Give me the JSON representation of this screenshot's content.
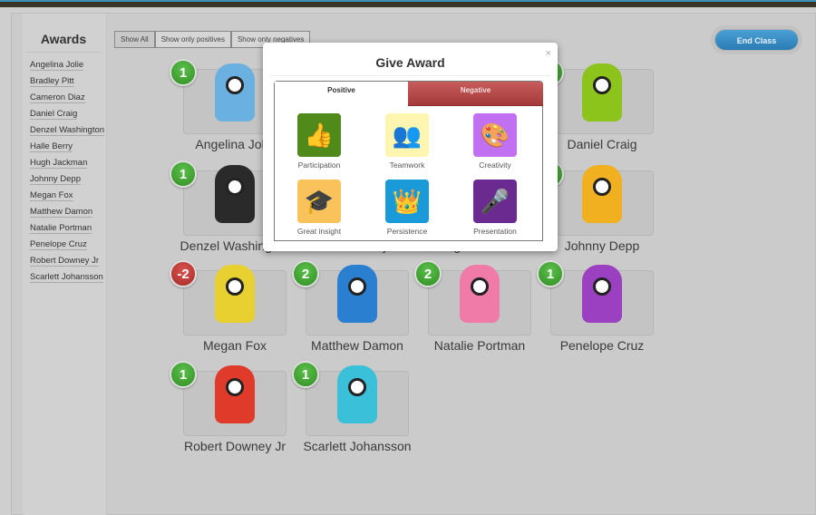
{
  "sidebar": {
    "title": "Awards",
    "students": [
      "Angelina Jolie",
      "Bradley Pitt",
      "Cameron Diaz",
      "Daniel Craig",
      "Denzel Washington",
      "Halle Berry",
      "Hugh Jackman",
      "Johnny Depp",
      "Megan Fox",
      "Matthew Damon",
      "Natalie Portman",
      "Penelope Cruz",
      "Robert Downey Jr",
      "Scarlett Johansson"
    ]
  },
  "filters": {
    "show_all": "Show All",
    "positives": "Show only positives",
    "negatives": "Show only negatives"
  },
  "end_class": "End Class",
  "cards": [
    {
      "name": "Angelina Jolie",
      "points": "1",
      "type": "pos",
      "color": "#6ab0e0"
    },
    {
      "name": "Bradley Pitt",
      "points": "",
      "type": "pos",
      "color": "#888"
    },
    {
      "name": "Cameron Diaz",
      "points": "",
      "type": "pos",
      "color": "#888"
    },
    {
      "name": "Daniel Craig",
      "points": "",
      "type": "pos",
      "color": "#8cc41c"
    },
    {
      "name": "Denzel Washington",
      "points": "1",
      "type": "pos",
      "color": "#2a2a2a"
    },
    {
      "name": "Halle Berry",
      "points": "",
      "type": "pos",
      "color": "#888"
    },
    {
      "name": "Hugh Jackman",
      "points": "",
      "type": "pos",
      "color": "#888"
    },
    {
      "name": "Johnny Depp",
      "points": "",
      "type": "pos",
      "color": "#f0b020"
    },
    {
      "name": "Megan Fox",
      "points": "-2",
      "type": "neg",
      "color": "#e8d030"
    },
    {
      "name": "Matthew Damon",
      "points": "2",
      "type": "pos",
      "color": "#2a7fd0"
    },
    {
      "name": "Natalie Portman",
      "points": "2",
      "type": "pos",
      "color": "#f07aa8"
    },
    {
      "name": "Penelope Cruz",
      "points": "1",
      "type": "pos",
      "color": "#9a40c0"
    },
    {
      "name": "Robert Downey Jr",
      "points": "1",
      "type": "pos",
      "color": "#e03a2a"
    },
    {
      "name": "Scarlett Johansson",
      "points": "1",
      "type": "pos",
      "color": "#3ac0d8"
    }
  ],
  "modal": {
    "title": "Give Award",
    "close": "×",
    "tab_positive": "Positive",
    "tab_negative": "Negative",
    "awards": [
      {
        "label": "Participation",
        "icon": "thumbs-up-icon",
        "glyph": "👍",
        "bg": "#4f8a1a"
      },
      {
        "label": "Teamwork",
        "icon": "people-icon",
        "glyph": "👥",
        "bg": "#fdf5b0"
      },
      {
        "label": "Creativity",
        "icon": "palette-icon",
        "glyph": "🎨",
        "bg": "#c070f0"
      },
      {
        "label": "Great insight",
        "icon": "graduation-cap-icon",
        "glyph": "🎓",
        "bg": "#f9c25a"
      },
      {
        "label": "Persistence",
        "icon": "crown-icon",
        "glyph": "👑",
        "bg": "#1a9ad8"
      },
      {
        "label": "Presentation",
        "icon": "microphone-icon",
        "glyph": "🎤",
        "bg": "#6a2a90"
      }
    ]
  }
}
